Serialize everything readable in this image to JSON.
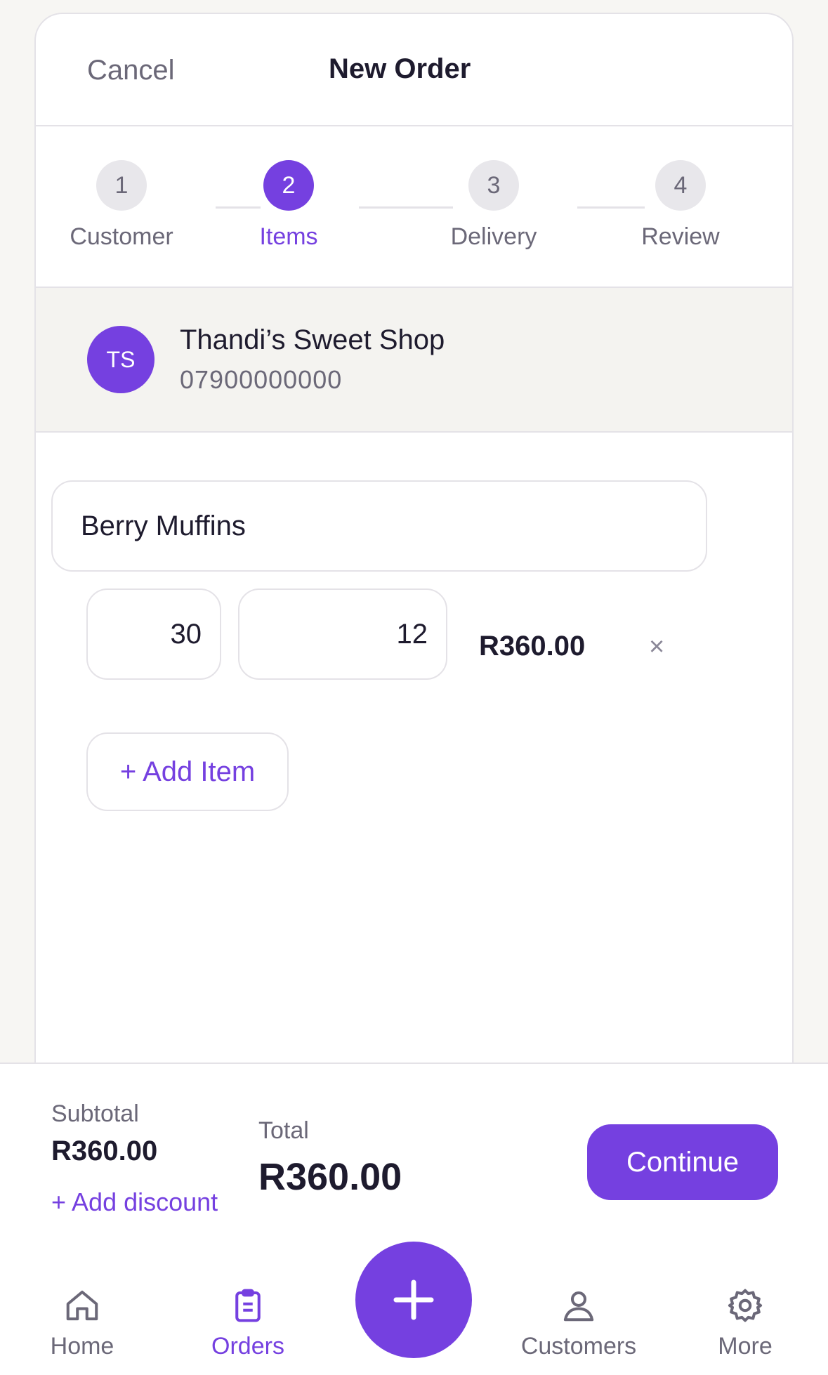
{
  "header": {
    "cancel_label": "Cancel",
    "title": "New Order"
  },
  "steps": [
    {
      "number": "1",
      "label": "Customer"
    },
    {
      "number": "2",
      "label": "Items"
    },
    {
      "number": "3",
      "label": "Delivery"
    },
    {
      "number": "4",
      "label": "Review"
    }
  ],
  "active_step": 2,
  "customer": {
    "initials": "TS",
    "name": "Thandi’s Sweet Shop",
    "phone": "07900000000"
  },
  "item": {
    "name": "Berry Muffins",
    "quantity": "30",
    "unit_price": "12",
    "line_total": "R360.00",
    "remove_icon": "close-icon",
    "remove_glyph": "×"
  },
  "add_item_label": "+ Add Item",
  "summary": {
    "subtotal_label": "Subtotal",
    "subtotal_value": "R360.00",
    "add_discount_label": "+ Add discount",
    "total_label": "Total",
    "total_value": "R360.00",
    "continue_label": "Continue"
  },
  "tabbar": {
    "home_label": "Home",
    "orders_label": "Orders",
    "customers_label": "Customers",
    "more_label": "More",
    "active": "Orders",
    "fab_icon": "plus-icon"
  },
  "colors": {
    "accent": "#7540e0",
    "muted_text": "#6b6878",
    "border": "#e4e2e7",
    "background": "#f7f6f3"
  }
}
